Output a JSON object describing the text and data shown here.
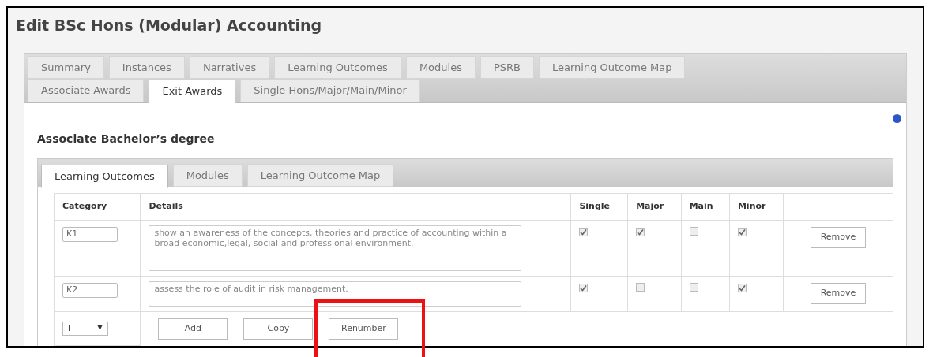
{
  "page": {
    "title": "Edit BSc Hons (Modular) Accounting"
  },
  "tab_rows": [
    [
      {
        "label": "Summary",
        "selected": false
      },
      {
        "label": "Instances",
        "selected": false
      },
      {
        "label": "Narratives",
        "selected": false
      },
      {
        "label": "Learning Outcomes",
        "selected": false
      },
      {
        "label": "Modules",
        "selected": false
      },
      {
        "label": "PSRB",
        "selected": false
      },
      {
        "label": "Learning Outcome Map",
        "selected": false
      }
    ],
    [
      {
        "label": "Associate Awards",
        "selected": false
      },
      {
        "label": "Exit Awards",
        "selected": true
      },
      {
        "label": "Single Hons/Major/Main/Minor",
        "selected": false
      }
    ]
  ],
  "section": {
    "heading": "Associate Bachelor’s degree"
  },
  "sub_tabs": [
    {
      "label": "Learning Outcomes",
      "selected": true
    },
    {
      "label": "Modules",
      "selected": false
    },
    {
      "label": "Learning Outcome Map",
      "selected": false
    }
  ],
  "table": {
    "columns": [
      "Category",
      "Details",
      "Single",
      "Major",
      "Main",
      "Minor"
    ],
    "rows": [
      {
        "category": "K1",
        "details": "show an awareness of the concepts, theories and practice of accounting within a broad economic,legal, social and professional environment.",
        "flags": [
          true,
          true,
          false,
          true
        ],
        "action": "Remove"
      },
      {
        "category": "K2",
        "details": "assess the role of audit in risk management.",
        "flags": [
          true,
          false,
          false,
          true
        ],
        "action": "Remove"
      }
    ],
    "footer": {
      "select_value": "I",
      "select_caret": "▼",
      "buttons": [
        {
          "label": "Add",
          "highlighted": false
        },
        {
          "label": "Copy",
          "highlighted": false
        },
        {
          "label": "Renumber",
          "highlighted": true
        }
      ]
    }
  }
}
